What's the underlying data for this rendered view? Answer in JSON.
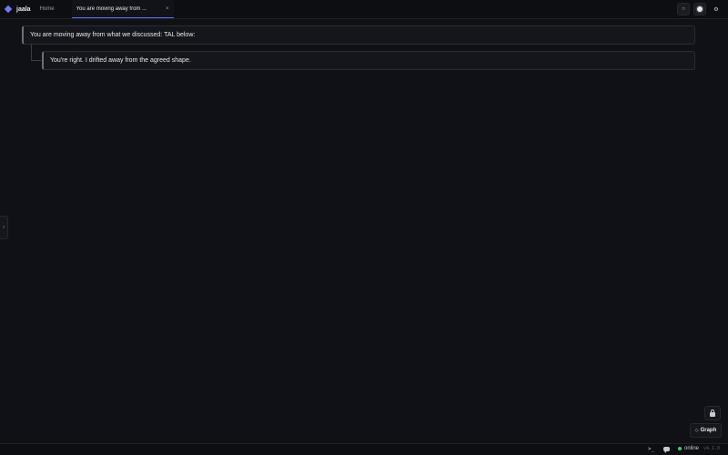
{
  "app": {
    "name": "jaala"
  },
  "tabs": {
    "home_label": "Home",
    "active_label": "You are moving away from ...",
    "close_glyph": "×"
  },
  "toolbar": {
    "left_glyph": "○",
    "settings_glyph": "⚙"
  },
  "messages": [
    {
      "role": "user",
      "text": "You are moving away from what we discussed: TAL below:"
    },
    {
      "role": "assistant",
      "text": "You're right. I drifted away from the agreed shape."
    }
  ],
  "side_handle": {
    "glyph": "›"
  },
  "graph_button": {
    "icon_glyph": "◇",
    "label": "Graph"
  },
  "status": {
    "terminal_glyph": ">_",
    "online_label": "online",
    "online_color": "#3ecf6e",
    "version": "v4.1.0"
  },
  "colors": {
    "accent": "#6b7cf2",
    "background": "#101116"
  },
  "icons": [
    "diamond-logo-icon",
    "close-icon",
    "circle-icon",
    "record-icon",
    "gear-icon",
    "chevron-right-icon",
    "lock-icon",
    "graph-icon",
    "terminal-icon",
    "chat-icon",
    "status-dot-icon"
  ]
}
